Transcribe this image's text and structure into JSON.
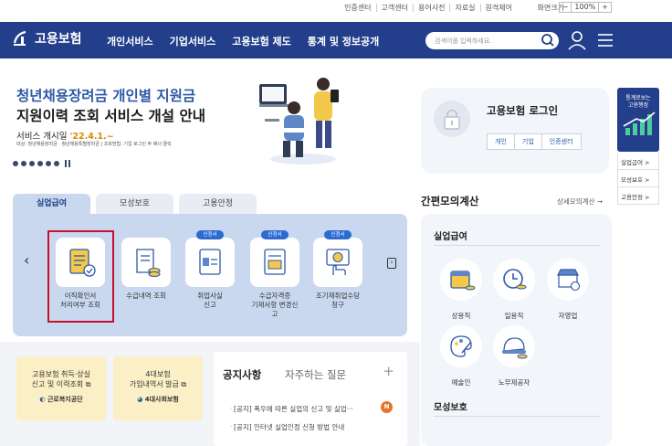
{
  "utility": {
    "links": [
      "인증센터",
      "고객센터",
      "용어사전",
      "자료실",
      "원격제어"
    ],
    "zoom_label": "화면크기",
    "zoom_minus": "−",
    "zoom_value": "100%",
    "zoom_plus": "+"
  },
  "header": {
    "logo_text": "고용보험",
    "nav": [
      "개인서비스",
      "기업서비스",
      "고용보험 제도",
      "통계 및 정보공개"
    ],
    "search_placeholder": "검색어를 입력하세요."
  },
  "hero": {
    "title_line1": "청년채용장려금 개인별 지원금",
    "title_line2": "지원이력 조회 서비스 개설 안내",
    "date_prefix": "서비스 개시일 ",
    "date_value": "'22.4.1.~",
    "note": "대상: 청년채용장려금 · 청년채용특별장려금 | 조회방법: 기업 로그인 후 배너 클릭"
  },
  "login": {
    "title": "고용보험 로그인",
    "buttons": [
      "개인",
      "기업",
      "인증센터"
    ]
  },
  "side": {
    "banner": [
      "통계로보는",
      "고용행정"
    ],
    "links": [
      "실업급여 >",
      "모성보호 >",
      "고용안정 >"
    ]
  },
  "tabs": [
    "실업급여",
    "모성보호",
    "고용안정"
  ],
  "services": [
    {
      "label": "이직확인서\n처리여부 조회",
      "tag": ""
    },
    {
      "label": "수급내역 조회",
      "tag": ""
    },
    {
      "label": "취업사실\n신고",
      "tag": "신청서"
    },
    {
      "label": "수급자격증\n기재사항 변경신고",
      "tag": "신청서"
    },
    {
      "label": "조기재취업수당\n청구",
      "tag": "신청서"
    }
  ],
  "calc": {
    "title": "간편모의계산",
    "more": "상세모의계산 →",
    "section1": "실업급여",
    "items": [
      "상용직",
      "일용직",
      "자영업",
      "예술인",
      "노무제공자"
    ],
    "section2": "모성보호"
  },
  "bottom": {
    "card_a_lines": [
      "고용보험 취득·상실",
      "신고 및 이력조회 ⧉"
    ],
    "card_a_org": "근로복지공단",
    "card_b_lines": [
      "4대보험",
      "가입내역서 발급 ⧉"
    ],
    "card_b_org": "4대사회보험",
    "notice_tab1": "공지사항",
    "notice_tab2": "자주하는 질문",
    "notices": [
      "[공지] 폭우에 따른 실업의 신고 및 실업···",
      "[공지] 인터넷 실업인정 신청 방법 안내"
    ],
    "new_badge": "N"
  },
  "colors": {
    "header_bg": "#233f8c",
    "highlight": "#c8102e",
    "panel_bg": "#c9d8ee"
  }
}
